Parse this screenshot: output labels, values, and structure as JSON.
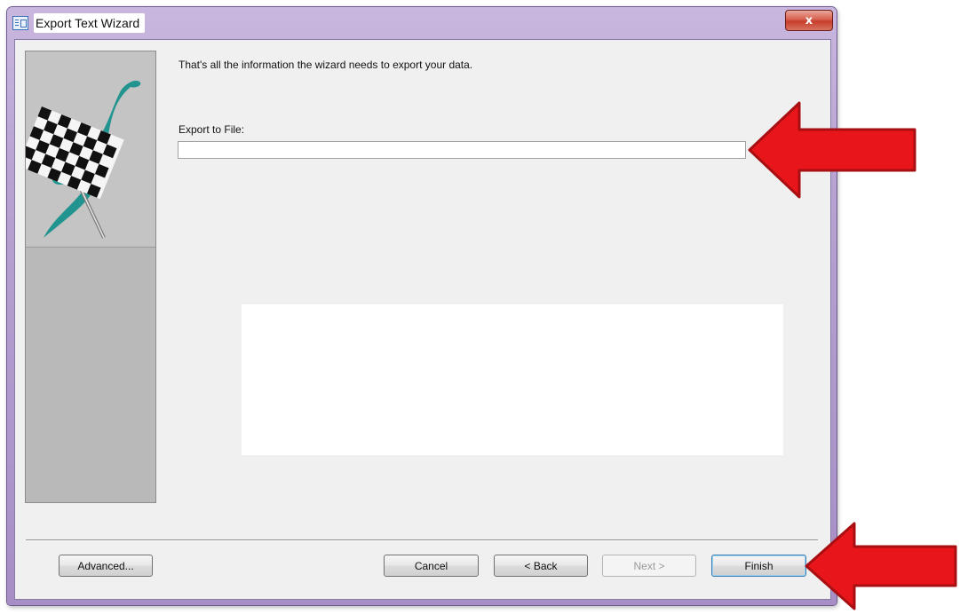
{
  "window": {
    "title": "Export Text Wizard",
    "close_glyph": "x",
    "icon": "wizard-window-icon"
  },
  "wizard": {
    "intro_text": "That's all the information the wizard needs to export your data.",
    "export_label": "Export to File:",
    "export_value": "",
    "export_placeholder": ""
  },
  "buttons": {
    "advanced": "Advanced...",
    "cancel": "Cancel",
    "back": "< Back",
    "next": "Next >",
    "finish": "Finish"
  },
  "annotations": {
    "arrow_color": "#e8161b",
    "arrow_outline": "#b01012"
  },
  "colors": {
    "titlebar": "#b7a2d2",
    "client_bg": "#f0f0f0",
    "side_panel": "#b9b9b9",
    "flag_teal": "#0f8f8a"
  }
}
